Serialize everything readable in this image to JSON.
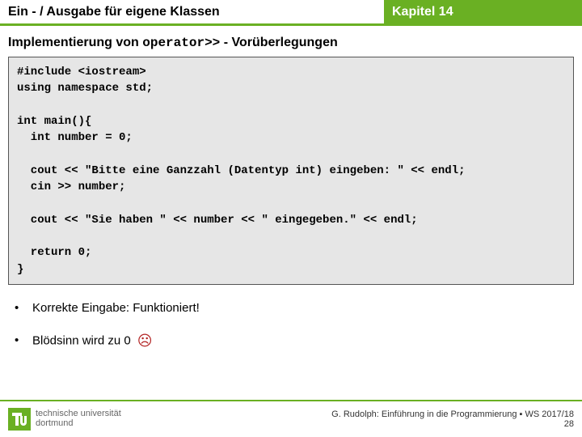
{
  "header": {
    "left": "Ein - / Ausgabe für eigene Klassen",
    "right": "Kapitel 14"
  },
  "subtitle": {
    "prefix": "Implementierung von ",
    "mono": "operator>>",
    "suffix": "  - Vorüberlegungen"
  },
  "code": "#include <iostream>\nusing namespace std;\n\nint main(){\n  int number = 0;\n\n  cout << \"Bitte eine Ganzzahl (Datentyp int) eingeben: \" << endl;\n  cin >> number;\n\n  cout << \"Sie haben \" << number << \" eingegeben.\" << endl;\n\n  return 0;\n}",
  "bullets": [
    {
      "text": "Korrekte Eingabe: Funktioniert!",
      "frown": false
    },
    {
      "text": "Blödsinn wird zu 0",
      "frown": true
    }
  ],
  "frown_glyph": "☹",
  "footer": {
    "uni_line1": "technische universität",
    "uni_line2": "dortmund",
    "credit": "G. Rudolph: Einführung in die Programmierung ▪ WS 2017/18",
    "page": "28"
  },
  "colors": {
    "accent": "#6ab023"
  }
}
